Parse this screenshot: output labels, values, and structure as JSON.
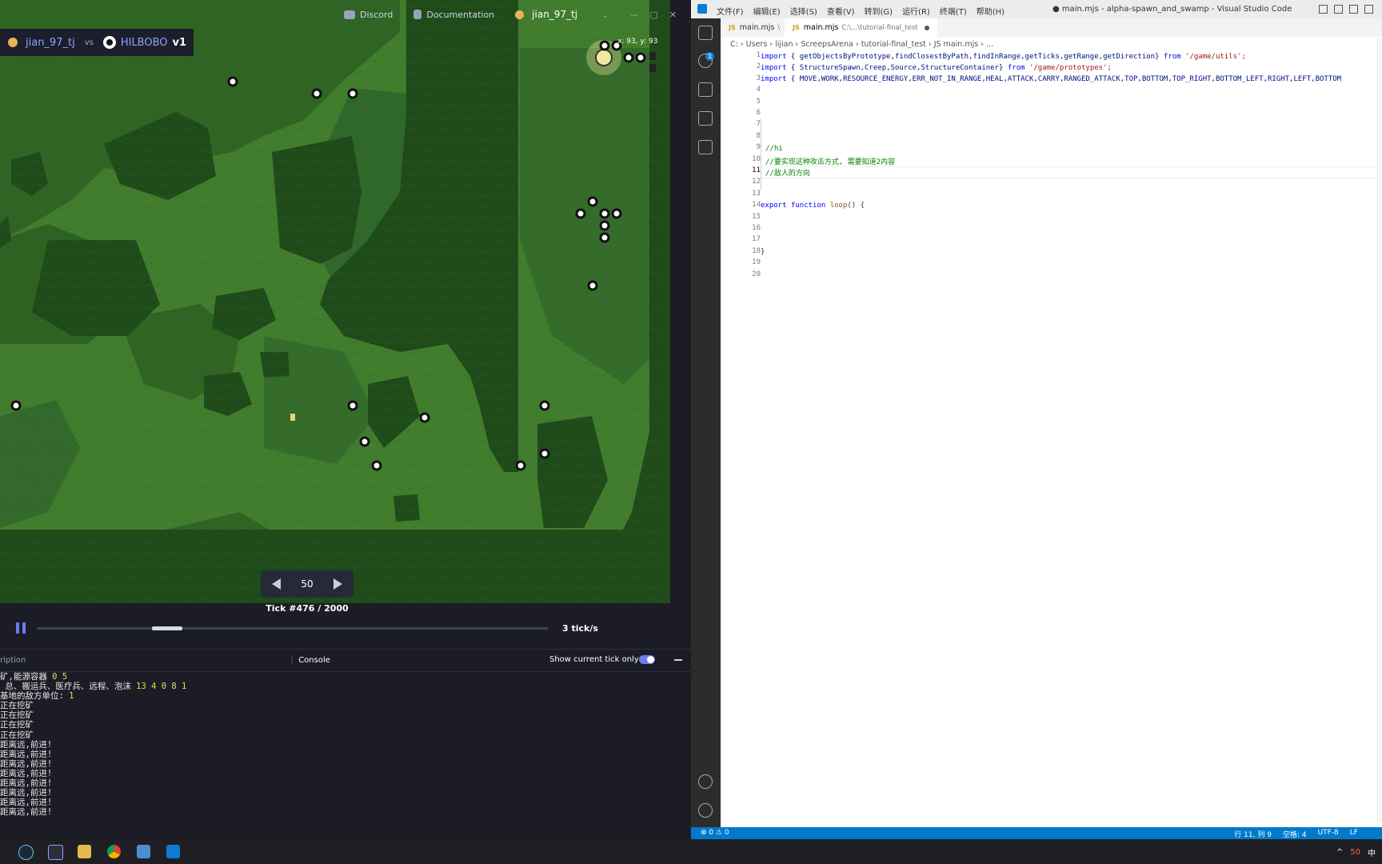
{
  "arena": {
    "player1": "jian_97_tj",
    "vs": "vs",
    "player2": "HILBOBO",
    "version": "v1",
    "nav": {
      "discord": "Discord",
      "docs": "Documentation",
      "user": "jian_97_tj"
    },
    "coord": "x: 93, y: 93",
    "step": "50",
    "tick": "Tick #476 / 2000",
    "speed": "3 tick/s",
    "console": {
      "desc_tab": "ription",
      "console_tab": "Console",
      "tick_only": "Show current tick only",
      "lines": [
        {
          "text": "矿,能源容器 ",
          "nums": "0 5"
        },
        {
          "text": " 总、搬运兵、医疗兵、远程、泡沫 ",
          "nums": "13 4 0 8 1"
        },
        {
          "text": "基地的敌方单位: ",
          "nums": "1"
        },
        {
          "text": "正在挖矿",
          "nums": ""
        },
        {
          "text": "正在挖矿",
          "nums": ""
        },
        {
          "text": "正在挖矿",
          "nums": ""
        },
        {
          "text": "正在挖矿",
          "nums": ""
        },
        {
          "text": "距离远,前进!",
          "nums": ""
        },
        {
          "text": "距离远,前进!",
          "nums": ""
        },
        {
          "text": "距离远,前进!",
          "nums": ""
        },
        {
          "text": "距离远,前进!",
          "nums": ""
        },
        {
          "text": "距离远,前进!",
          "nums": ""
        },
        {
          "text": "距离远,前进!",
          "nums": ""
        },
        {
          "text": "距离远,前进!",
          "nums": ""
        },
        {
          "text": "距离远,前进!",
          "nums": ""
        }
      ]
    },
    "colors": {
      "accent": "#6c7df0",
      "grass": "#3f7a2c",
      "wall": "#1f4a1a",
      "swamp": "#2c5f22"
    }
  },
  "vscode": {
    "menus": [
      "文件(F)",
      "编辑(E)",
      "选择(S)",
      "查看(V)",
      "转到(G)",
      "运行(R)",
      "终端(T)",
      "帮助(H)"
    ],
    "window_title": "● main.mjs - alpha-spawn_and_swamp - Visual Studio Code",
    "tab1": "main.mjs",
    "tab1_suffix": "\\",
    "tab2": "main.mjs",
    "tab2_path": "C:\\...\\tutorial-final_test",
    "breadcrumb": "C: › Users › lijian › ScreepsArena › tutorial-final_test › JS main.mjs › ...",
    "badge": "2",
    "line_numbers": [
      "1",
      "2",
      "3",
      "4",
      "5",
      "6",
      "7",
      "8",
      "9",
      "10",
      "11",
      "12",
      "13",
      "14",
      "15",
      "16",
      "17",
      "18",
      "19",
      "20"
    ],
    "code": {
      "l1_import": "import",
      "l1_body": " { getObjectsByPrototype,findClosestByPath,findInRange,getTicks,getRange,getDirection} ",
      "l1_from": "from",
      "l1_str": " '/game/utils';",
      "l2_import": "import",
      "l2_body": " { StructureSpawn,Creep,Source,StructureContainer} ",
      "l2_from": "from",
      "l2_str": " '/game/prototypes';",
      "l3_import": "import",
      "l3_body": " { MOVE,WORK,RESOURCE_ENERGY,ERR_NOT_IN_RANGE,HEAL,ATTACK,CARRY,RANGED_ATTACK,TOP,BOTTOM,TOP_RIGHT,BOTTOM_LEFT,RIGHT,LEFT,BOTTOM",
      "l9": "//hi",
      "l10": "//要实现这种攻击方式, 需要知道2内容",
      "l11": "//敌人的方向",
      "l14_export": "export",
      "l14_function": "function",
      "l14_name": "loop",
      "l14_rest": "() {",
      "l18": "}"
    },
    "status": {
      "problems": "⊗ 0 ⚠ 0",
      "position": "行 11, 列 9",
      "spaces": "空格: 4",
      "encoding": "UTF-8",
      "eol": "LF"
    }
  },
  "taskbar": {
    "tray": [
      "^",
      "50",
      "中"
    ],
    "apps": [
      "steam-icon",
      "terminal-icon",
      "files-icon",
      "chrome-icon",
      "app-icon",
      "vscode-icon"
    ]
  }
}
